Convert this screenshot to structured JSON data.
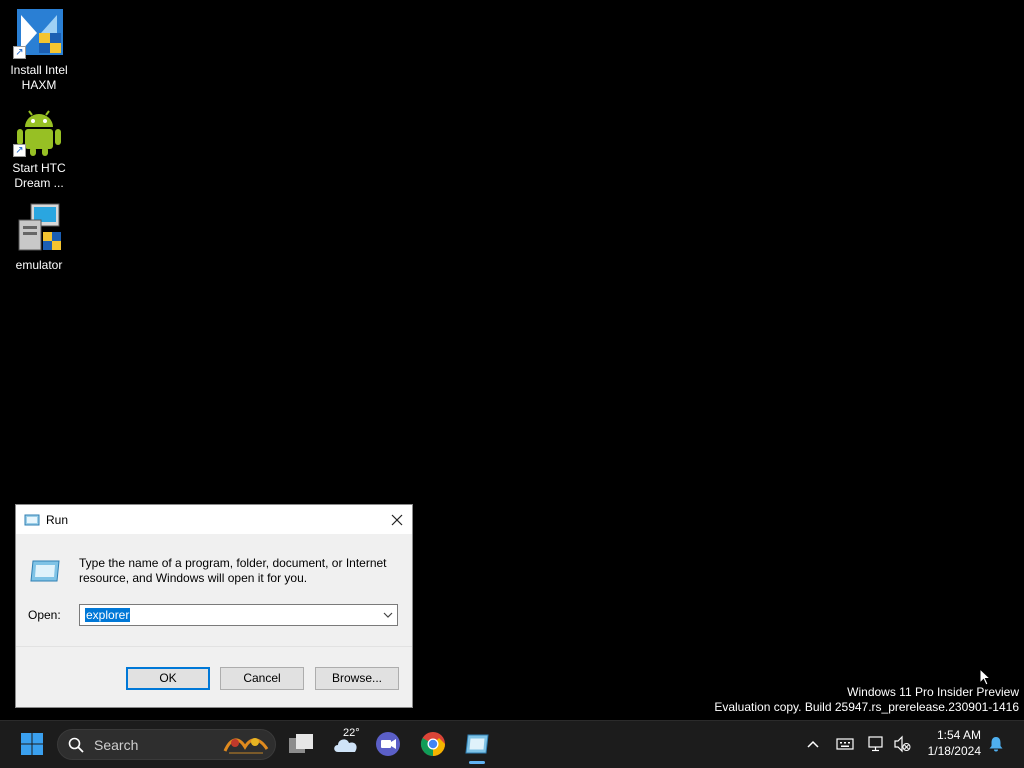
{
  "desktop": {
    "icons": [
      {
        "label_line1": "Install Intel",
        "label_line2": "HAXM",
        "icon": "haxm-installer-icon"
      },
      {
        "label_line1": "Start HTC",
        "label_line2": "Dream ...",
        "icon": "android-robot-icon"
      },
      {
        "label_line1": "emulator",
        "label_line2": "",
        "icon": "installer-package-icon"
      }
    ]
  },
  "run_dialog": {
    "title": "Run",
    "description": "Type the name of a program, folder, document, or Internet resource, and Windows will open it for you.",
    "open_label": "Open:",
    "open_value": "explorer",
    "ok_label": "OK",
    "cancel_label": "Cancel",
    "browse_label": "Browse..."
  },
  "watermark": {
    "line1": "Windows 11 Pro Insider Preview",
    "line2": "Evaluation copy. Build 25947.rs_prerelease.230901-1416"
  },
  "taskbar": {
    "search_placeholder": "Search",
    "weather_temp": "22°",
    "apps": [
      "start-icon",
      "task-view-icon",
      "weather-icon",
      "meet-icon",
      "chrome-icon",
      "run-app-icon"
    ],
    "tray": [
      "chevron-up-icon",
      "keyboard-icon",
      "network-icon",
      "volume-muted-icon"
    ],
    "time": "1:54 AM",
    "date": "1/18/2024"
  },
  "colors": {
    "accent": "#0078d7",
    "taskbar_bg": "#1c1c1c",
    "desktop_bg": "#000000"
  }
}
